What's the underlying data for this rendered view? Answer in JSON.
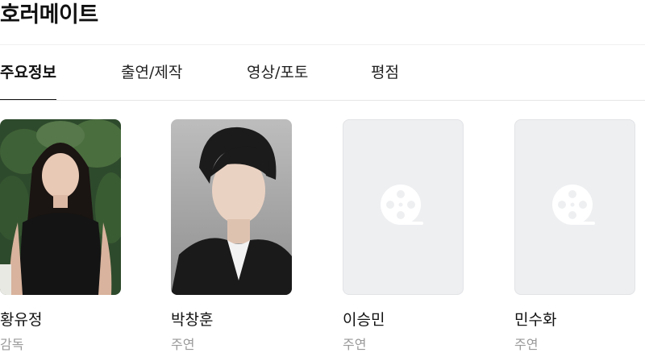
{
  "title": "호러메이트",
  "tabs": [
    {
      "label": "주요정보",
      "active": true
    },
    {
      "label": "출연/제작",
      "active": false
    },
    {
      "label": "영상/포토",
      "active": false
    },
    {
      "label": "평점",
      "active": false
    }
  ],
  "cast": [
    {
      "name": "황유정",
      "role": "감독",
      "photo": "photo"
    },
    {
      "name": "박창훈",
      "role": "주연",
      "photo": "photo"
    },
    {
      "name": "이승민",
      "role": "주연",
      "photo": "film-reel-icon"
    },
    {
      "name": "민수화",
      "role": "주연",
      "photo": "film-reel-icon"
    }
  ],
  "colors": {
    "text": "#111111",
    "secondary_text": "#9a9a9a",
    "placeholder_bg": "#eeeff1",
    "divider": "#e6e6e6"
  }
}
